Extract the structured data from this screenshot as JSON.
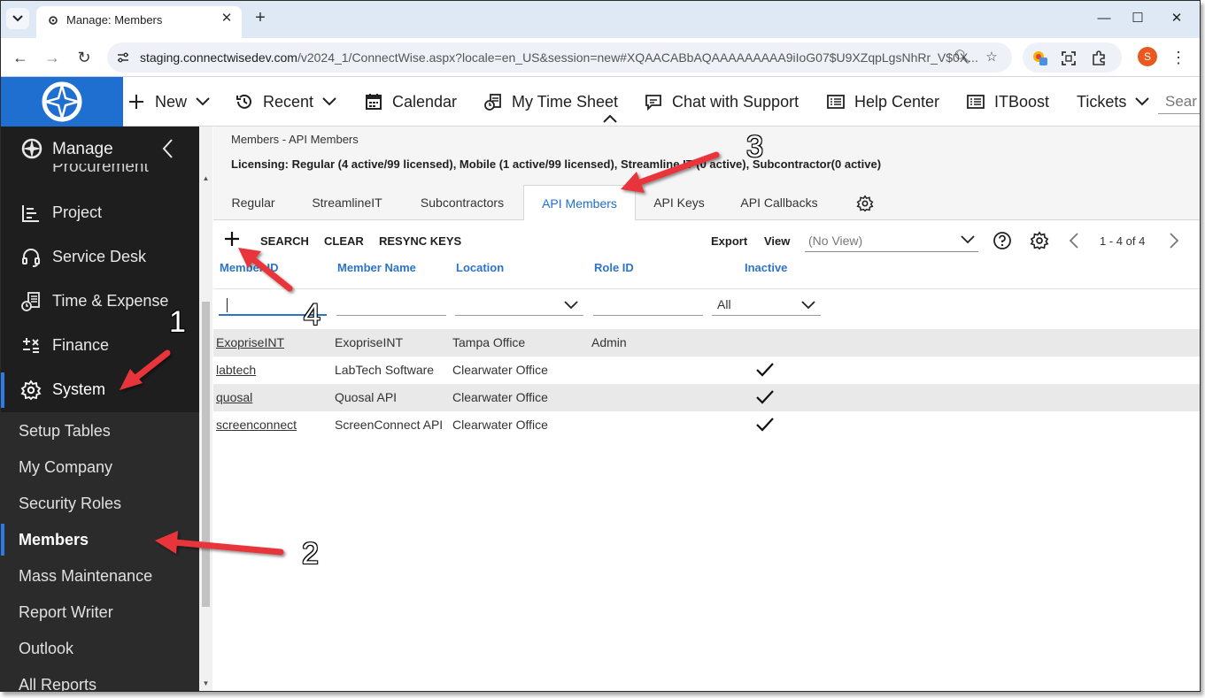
{
  "browser": {
    "tab_title": "Manage: Members",
    "url_host": "staging.connectwisedev.com",
    "url_rest": "/v2024_1/ConnectWise.aspx?locale=en_US&session=new#XQAACABbAQAAAAAAAAA9iIoG07$U9XZqpLgsNhRr_V$0X...",
    "profile_initial": "S"
  },
  "topnav": {
    "items": [
      {
        "label": "New",
        "icon": "plus-icon"
      },
      {
        "label": "Recent",
        "icon": "history-icon"
      },
      {
        "label": "Calendar",
        "icon": "calendar-icon"
      },
      {
        "label": "My Time Sheet",
        "icon": "timesheet-icon"
      },
      {
        "label": "Chat with Support",
        "icon": "chat-icon"
      },
      {
        "label": "Help Center",
        "icon": "help-center-icon"
      },
      {
        "label": "ITBoost",
        "icon": "itboost-icon"
      },
      {
        "label": "Tickets",
        "icon": ""
      }
    ],
    "search_placeholder": "Sear"
  },
  "sidebar": {
    "header": "Manage",
    "cut_item": "Procurement",
    "items": [
      {
        "label": "Project",
        "icon": "project-icon"
      },
      {
        "label": "Service Desk",
        "icon": "headset-icon"
      },
      {
        "label": "Time & Expense",
        "icon": "time-expense-icon"
      },
      {
        "label": "Finance",
        "icon": "finance-icon"
      },
      {
        "label": "System",
        "icon": "gear-icon"
      }
    ],
    "sub_items": [
      {
        "label": "Setup Tables"
      },
      {
        "label": "My Company"
      },
      {
        "label": "Security Roles"
      },
      {
        "label": "Members"
      },
      {
        "label": "Mass Maintenance"
      },
      {
        "label": "Report Writer"
      },
      {
        "label": "Outlook"
      },
      {
        "label": "All Reports"
      }
    ]
  },
  "content": {
    "breadcrumb": "Members - API Members",
    "licensing": "Licensing: Regular (4 active/99 licensed), Mobile (1 active/99 licensed), Streamline IT (0 active), Subcontractor(0 active)",
    "tabs": [
      "Regular",
      "StreamlineIT",
      "Subcontractors",
      "API Members",
      "API Keys",
      "API Callbacks"
    ],
    "toolbar": {
      "search": "SEARCH",
      "clear": "CLEAR",
      "resync": "RESYNC KEYS",
      "export": "Export",
      "view": "View",
      "view_placeholder": "(No View)",
      "pager": "1 - 4 of 4"
    },
    "columns": [
      "Member ID",
      "Member Name",
      "Location",
      "Role ID",
      "Inactive"
    ],
    "inactive_filter": "All",
    "rows": [
      {
        "member_id": "ExopriseINT",
        "member_name": "ExopriseINT",
        "location": "Tampa Office",
        "role_id": "Admin",
        "inactive": false
      },
      {
        "member_id": "labtech",
        "member_name": "LabTech Software",
        "location": "Clearwater Office",
        "role_id": "",
        "inactive": true
      },
      {
        "member_id": "quosal",
        "member_name": "Quosal API",
        "location": "Clearwater Office",
        "role_id": "",
        "inactive": true
      },
      {
        "member_id": "screenconnect",
        "member_name": "ScreenConnect API",
        "location": "Clearwater Office",
        "role_id": "",
        "inactive": true
      }
    ]
  },
  "annotations": {
    "n1": "1",
    "n2": "2",
    "n3": "3",
    "n4": "4",
    "arrow_color": "#e8343a"
  },
  "colors": {
    "brand_blue": "#1f6fd1",
    "link_blue": "#2d74c9",
    "sidebar_dark": "#1e1e1e"
  }
}
